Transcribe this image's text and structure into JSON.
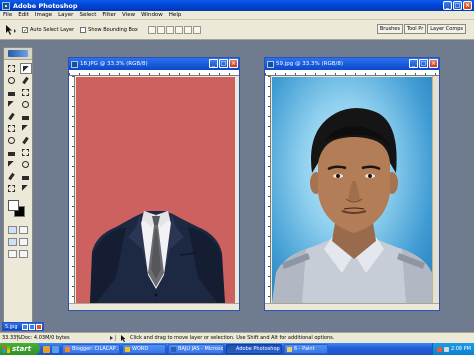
{
  "app": {
    "title": "Adobe Photoshop",
    "window_controls": [
      "_",
      "□",
      "×"
    ]
  },
  "menu": [
    "File",
    "Edit",
    "Image",
    "Layer",
    "Select",
    "Filter",
    "View",
    "Window",
    "Help"
  ],
  "options_bar": {
    "auto_select_layer": {
      "label": "Auto Select Layer",
      "checked": true
    },
    "show_bounding_box": {
      "label": "Show Bounding Box",
      "checked": false
    },
    "palette_tabs": [
      "Brushes",
      "Tool Pr",
      "Layer Comps"
    ]
  },
  "toolbox": {
    "tools": [
      "marquee-tool",
      "move-tool",
      "lasso-tool",
      "magic-wand-tool",
      "crop-tool",
      "slice-tool",
      "healing-brush-tool",
      "brush-tool",
      "clone-stamp-tool",
      "history-brush-tool",
      "eraser-tool",
      "gradient-tool",
      "blur-tool",
      "dodge-tool",
      "path-selection-tool",
      "type-tool",
      "pen-tool",
      "shape-tool",
      "notes-tool",
      "eyedropper-tool",
      "hand-tool",
      "zoom-tool"
    ],
    "active_tool": "move-tool",
    "foreground_color": "#ffffff",
    "background_color": "#000000"
  },
  "documents": [
    {
      "title": "18.JPG @ 33.3% (RGB/8)",
      "canvas_background": "#cd615f",
      "content": "suit-template"
    },
    {
      "title": "59.jpg @ 33.3% (RGB/8)",
      "canvas_background": "#4aa6dc",
      "content": "portrait-photo"
    }
  ],
  "minimized_window": {
    "title": "5.jpg"
  },
  "status_bar": {
    "zoom": "33.33%",
    "doc_size": "Doc: 4.03M/0 bytes",
    "hint": "Click and drag to move layer or selection.  Use Shift and Alt for additional options."
  },
  "taskbar": {
    "start_label": "start",
    "buttons": [
      {
        "label": "Blogger: CILACAP ...",
        "active": false,
        "icon_color": "#f08a24"
      },
      {
        "label": "WORD",
        "active": false,
        "icon_color": "#f0c419"
      },
      {
        "label": "BAJU JAS - Microso...",
        "active": false,
        "icon_color": "#2b5fb8"
      },
      {
        "label": "Adobe Photoshop",
        "active": true,
        "icon_color": "#2a5aa5"
      },
      {
        "label": "6 - Paint",
        "active": false,
        "icon_color": "#e8d060"
      }
    ],
    "clock": "2:08 PM"
  }
}
